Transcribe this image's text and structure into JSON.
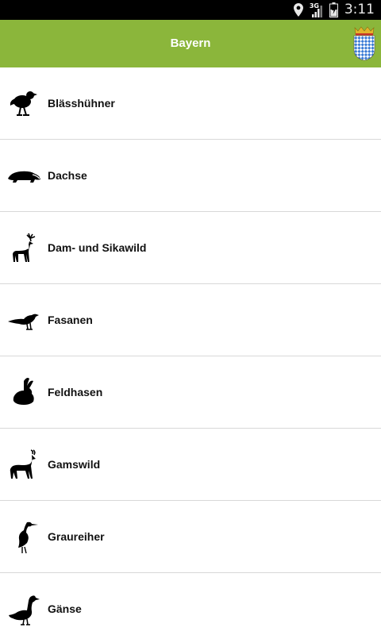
{
  "status_bar": {
    "time": "3:11",
    "network_type": "3G",
    "icons": [
      "location-icon",
      "signal-icon",
      "battery-icon"
    ]
  },
  "app_bar": {
    "title": "Bayern",
    "background_color": "#8bb63b",
    "crest_icon": "bavaria-crest-icon"
  },
  "list": {
    "items": [
      {
        "label": "Blässhühner",
        "icon": "coot-icon"
      },
      {
        "label": "Dachse",
        "icon": "badger-icon"
      },
      {
        "label": "Dam- und Sikawild",
        "icon": "deer-icon"
      },
      {
        "label": "Fasanen",
        "icon": "pheasant-icon"
      },
      {
        "label": "Feldhasen",
        "icon": "hare-icon"
      },
      {
        "label": "Gamswild",
        "icon": "chamois-icon"
      },
      {
        "label": "Graureiher",
        "icon": "heron-icon"
      },
      {
        "label": "Gänse",
        "icon": "goose-icon"
      }
    ]
  }
}
